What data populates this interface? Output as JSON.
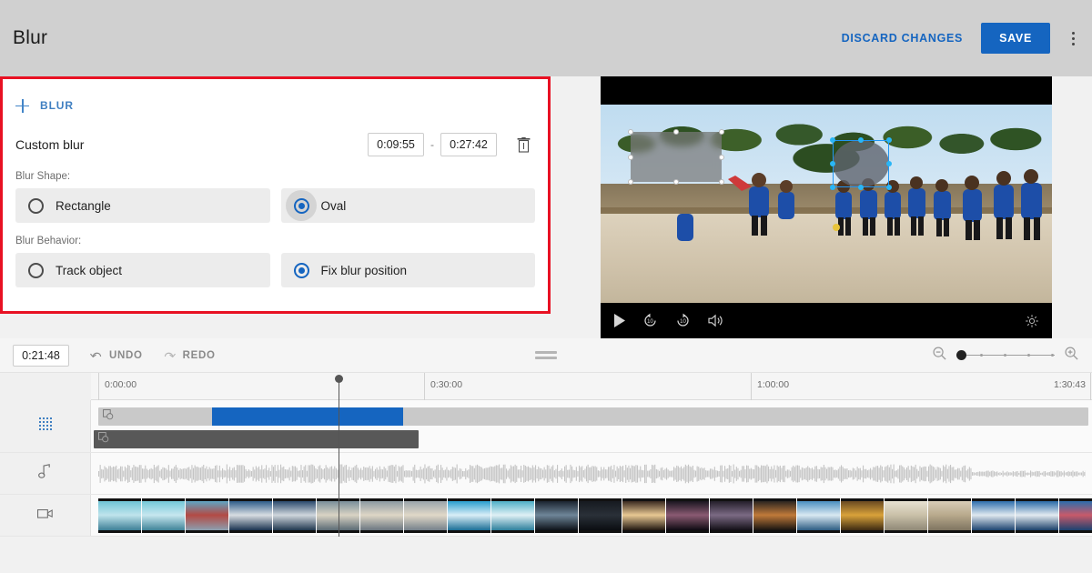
{
  "header": {
    "title": "Blur",
    "discard_label": "DISCARD CHANGES",
    "save_label": "SAVE",
    "more_icon": "kebab-menu-icon"
  },
  "edit_panel": {
    "add_blur_label": "BLUR",
    "add_icon": "plus-icon",
    "item_label": "Custom blur",
    "start_time": "0:09:55",
    "end_time": "0:27:42",
    "time_separator": "-",
    "delete_icon": "trash-icon",
    "shape_group_label": "Blur Shape:",
    "shape_options": [
      {
        "label": "Rectangle",
        "selected": false,
        "swatch": "rect-swatch"
      },
      {
        "label": "Oval",
        "selected": true,
        "swatch": "oval-swatch"
      }
    ],
    "behavior_group_label": "Blur Behavior:",
    "behavior_options": [
      {
        "label": "Track object",
        "selected": false
      },
      {
        "label": "Fix blur position",
        "selected": true
      }
    ],
    "accent_selected": "#1565c0",
    "highlight_border": "#e81123"
  },
  "preview": {
    "play_icon": "play-icon",
    "rewind_icon": "replay-10-icon",
    "forward_icon": "forward-10-icon",
    "volume_icon": "volume-icon",
    "settings_icon": "gear-icon",
    "regions": [
      {
        "shape": "rectangle",
        "selected": false,
        "handle_color": "#ffffff"
      },
      {
        "shape": "oval",
        "selected": true,
        "handle_color": "#29b6f6"
      }
    ]
  },
  "timeline": {
    "current_time": "0:21:48",
    "undo_label": "UNDO",
    "redo_label": "REDO",
    "undo_icon": "undo-arrow-icon",
    "redo_icon": "redo-arrow-icon",
    "drag_handle_icon": "drag-handle-icon",
    "zoom_out_icon": "zoom-out-icon",
    "zoom_in_icon": "zoom-in-icon",
    "zoom_value": 0,
    "ruler_labels": [
      "0:00:00",
      "0:30:00",
      "1:00:00"
    ],
    "duration_label": "1:30:43",
    "tracks": [
      {
        "name": "effects",
        "icon": "blur-grid-icon"
      },
      {
        "name": "audio",
        "icon": "music-note-icon"
      },
      {
        "name": "video",
        "icon": "video-camera-icon"
      }
    ],
    "clip_icon": "blur-clip-icon",
    "selected_clip_color": "#1565c0"
  }
}
